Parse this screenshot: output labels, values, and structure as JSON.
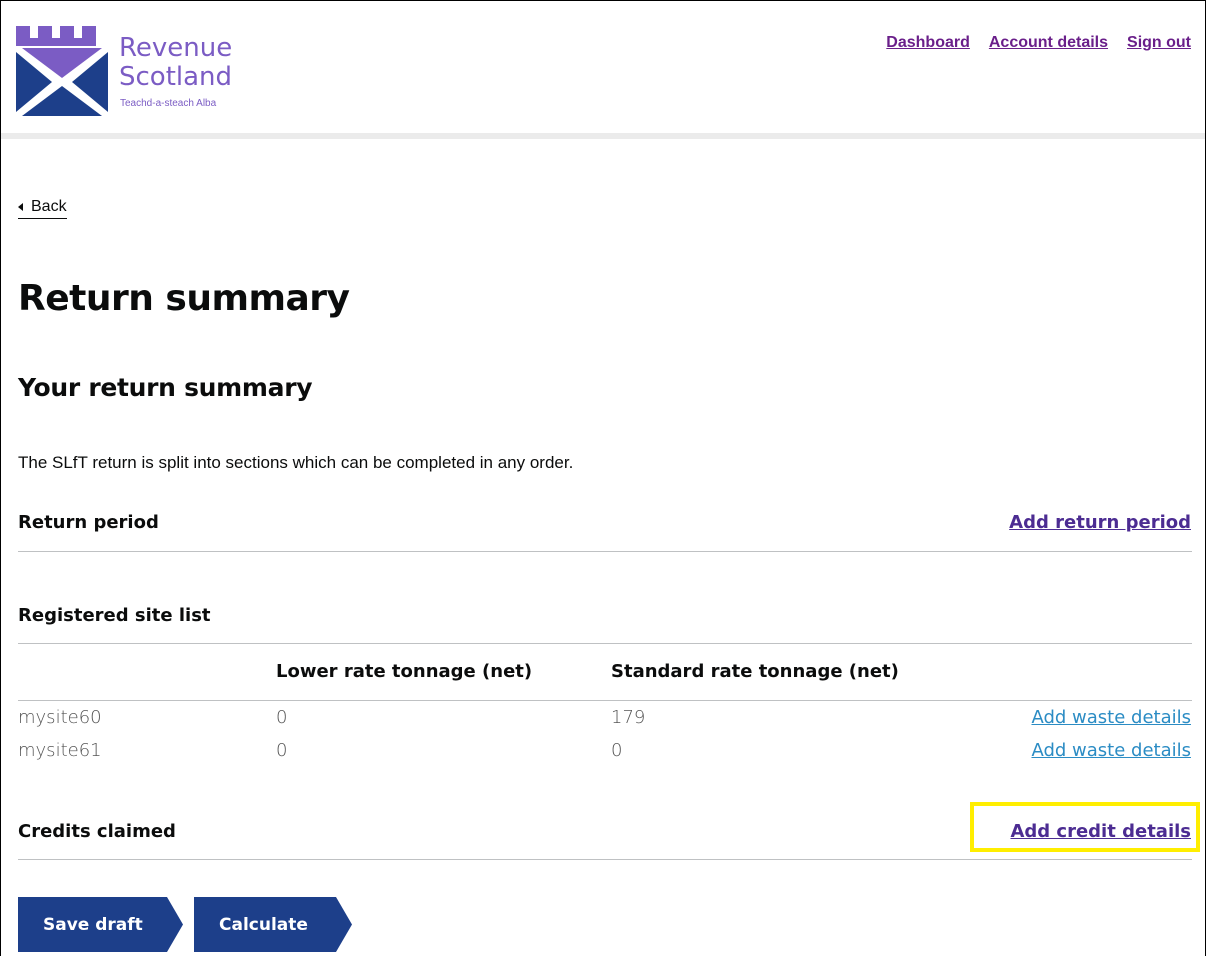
{
  "brand": {
    "name_line1": "Revenue",
    "name_line2": "Scotland",
    "gaelic": "Teachd-a-steach Alba",
    "color": "#7b5cc4",
    "flag_color": "#1d3f8a"
  },
  "nav": {
    "dashboard": "Dashboard",
    "account_details": "Account details",
    "sign_out": "Sign out"
  },
  "back_label": "Back",
  "page_title": "Return summary",
  "subtitle": "Your return summary",
  "intro": "The SLfT return is split into sections which can be completed in any order.",
  "return_period": {
    "title": "Return period",
    "link": "Add return period"
  },
  "sites": {
    "title": "Registered site list",
    "columns": [
      "",
      "Lower rate tonnage (net)",
      "Standard rate tonnage (net)",
      ""
    ],
    "rows": [
      {
        "name": "mysite60",
        "lower": "0",
        "standard": "179",
        "link": "Add waste details"
      },
      {
        "name": "mysite61",
        "lower": "0",
        "standard": "0",
        "link": "Add waste details"
      }
    ]
  },
  "credits": {
    "title": "Credits claimed",
    "link": "Add credit details",
    "highlight_color": "#ffee00"
  },
  "buttons": {
    "save_draft": "Save draft",
    "calculate": "Calculate"
  }
}
